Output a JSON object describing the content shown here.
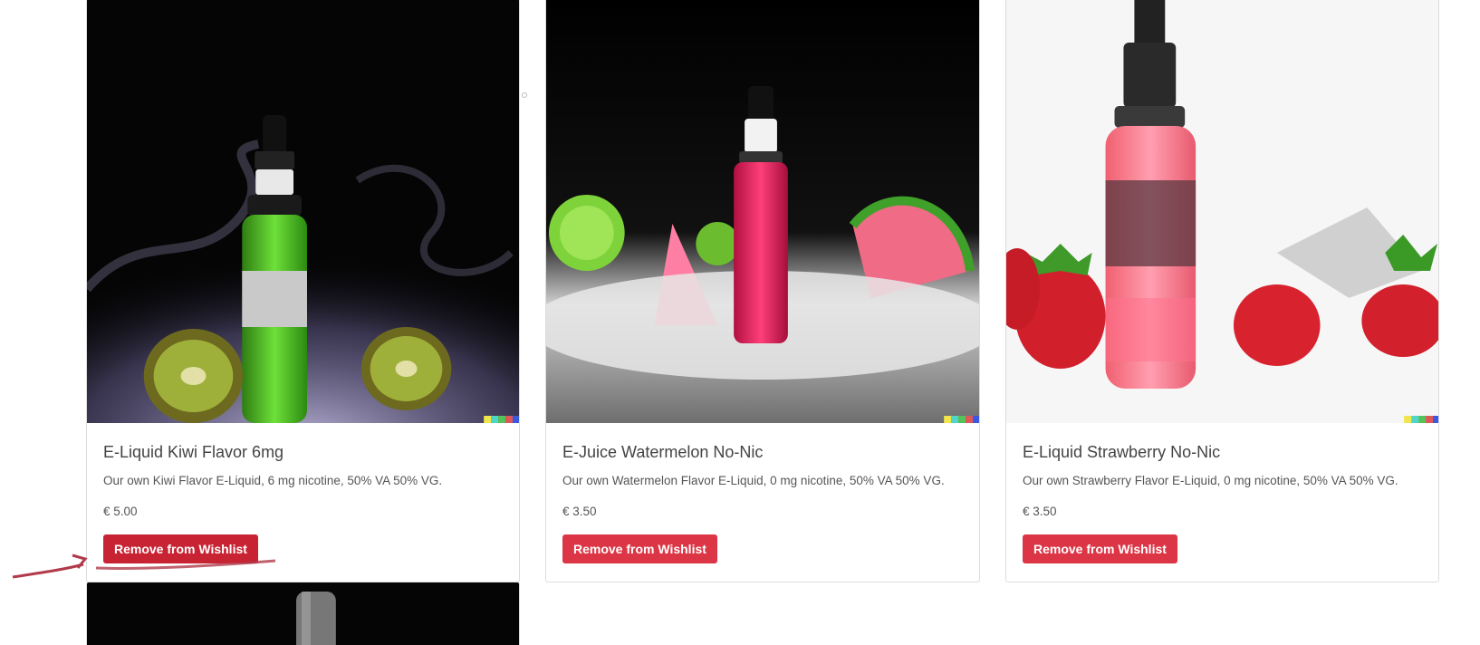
{
  "products": [
    {
      "title": "E-Liquid Kiwi Flavor 6mg",
      "description": "Our own Kiwi Flavor E-Liquid, 6 mg nicotine, 50% VA 50% VG.",
      "price": "€ 5.00",
      "button_label": "Remove from Wishlist"
    },
    {
      "title": "E-Juice Watermelon No-Nic",
      "description": "Our own Watermelon Flavor E-Liquid, 0 mg nicotine, 50% VA 50% VG.",
      "price": "€ 3.50",
      "button_label": "Remove from Wishlist"
    },
    {
      "title": "E-Liquid Strawberry No-Nic",
      "description": "Our own Strawberry Flavor E-Liquid, 0 mg nicotine, 50% VA 50% VG.",
      "price": "€ 3.50",
      "button_label": "Remove from Wishlist"
    }
  ],
  "colors": {
    "button": "#dc3545",
    "button_hover": "#c82333",
    "annotation": "#b03a4a"
  },
  "icons": [
    "cursor-annotation-arrow"
  ]
}
